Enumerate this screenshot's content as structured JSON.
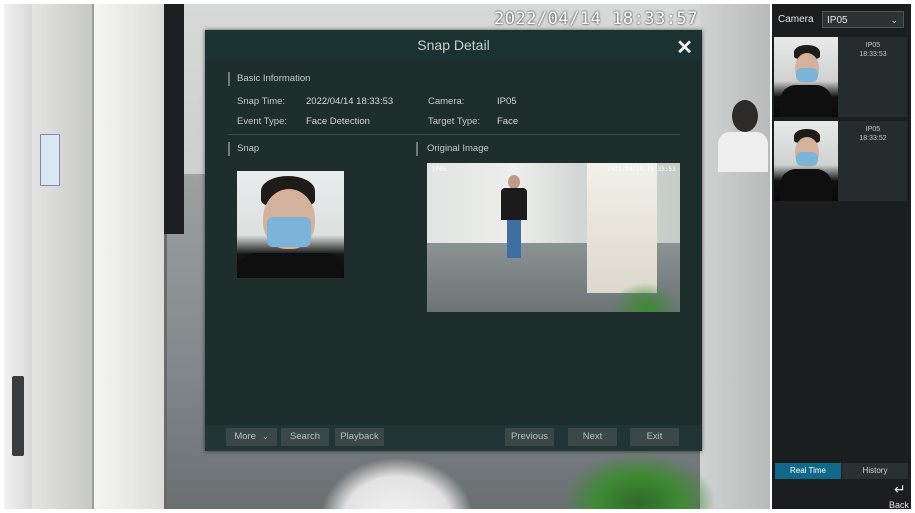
{
  "video": {
    "osd_time": "2022/04/14 18:33:57"
  },
  "sidebar": {
    "camera_label": "Camera",
    "camera_value": "IP05",
    "snaps": [
      {
        "camera": "IP05",
        "time": "18:33:53"
      },
      {
        "camera": "IP05",
        "time": "18:33:52"
      }
    ],
    "tabs": {
      "realtime": "Real Time",
      "history": "History"
    },
    "back_label": "Back"
  },
  "dialog": {
    "title": "Snap Detail",
    "basic_info_title": "Basic Information",
    "snap_time_label": "Snap Time:",
    "snap_time_value": "2022/04/14 18:33:53",
    "camera_label": "Camera:",
    "camera_value": "IP05",
    "event_type_label": "Event Type:",
    "event_type_value": "Face Detection",
    "target_type_label": "Target Type:",
    "target_type_value": "Face",
    "snap_section_title": "Snap",
    "original_section_title": "Original Image",
    "original_osd_camera": "IP05",
    "original_osd_time": "2022/04/14 18:33:53",
    "buttons": {
      "more": "More",
      "search": "Search",
      "playback": "Playback",
      "previous": "Previous",
      "next": "Next",
      "exit": "Exit"
    }
  },
  "colors": {
    "accent": "#11698a",
    "dialog_bg": "#1d2e2c",
    "sidebar_bg": "#1a1e1f"
  },
  "icons": [
    "close-icon",
    "chevron-down-icon",
    "back-arrow-icon"
  ]
}
